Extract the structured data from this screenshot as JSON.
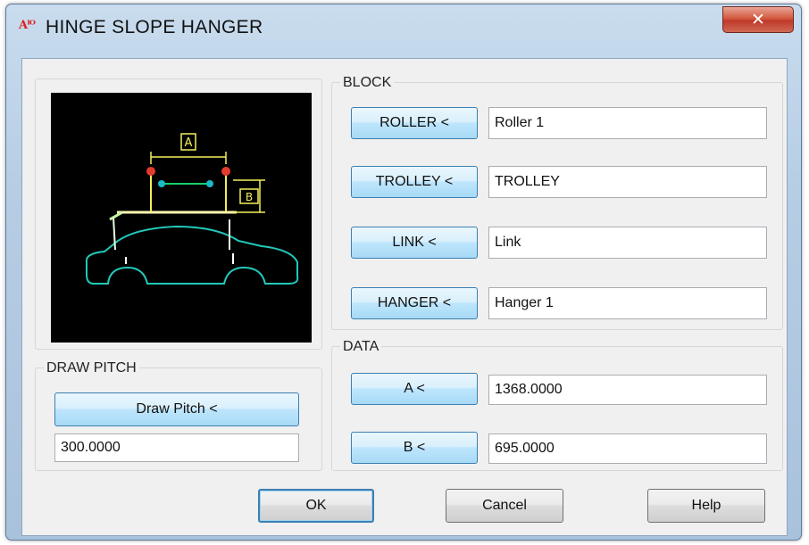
{
  "window": {
    "app_icon_text": "Aᴵᴼ",
    "title": "HINGE SLOPE HANGER",
    "close_label": "✕"
  },
  "block_group": {
    "label": "BLOCK",
    "rows": [
      {
        "button": "ROLLER <",
        "value": "Roller 1"
      },
      {
        "button": "TROLLEY <",
        "value": "TROLLEY"
      },
      {
        "button": "LINK <",
        "value": "Link"
      },
      {
        "button": "HANGER <",
        "value": "Hanger 1"
      }
    ]
  },
  "data_group": {
    "label": "DATA",
    "rows": [
      {
        "button": "A <",
        "value": "1368.0000"
      },
      {
        "button": "B <",
        "value": "695.0000"
      }
    ]
  },
  "draw_pitch_group": {
    "label": "DRAW PITCH",
    "button": "Draw Pitch <",
    "value": "300.0000"
  },
  "preview": {
    "dim_a_label": "A",
    "dim_b_label": "B"
  },
  "footer": {
    "ok": "OK",
    "cancel": "Cancel",
    "help": "Help"
  }
}
